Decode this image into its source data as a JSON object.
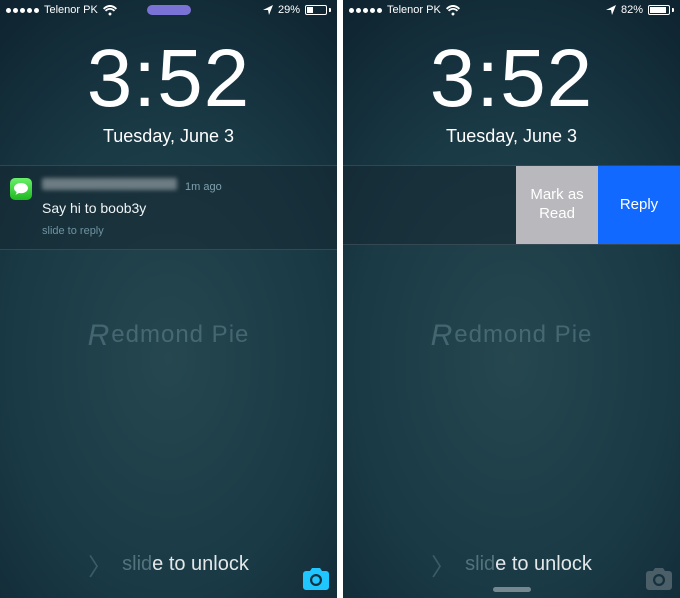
{
  "left": {
    "status": {
      "carrier": "Telenor PK",
      "signal_dots": 5,
      "wifi_bars": 3,
      "has_loading_pill": true,
      "location_arrow": true,
      "battery_pct_label": "29%",
      "battery_fill_pct": 29
    },
    "time": "3:52",
    "date": "Tuesday, June 3",
    "notif": {
      "app_icon_name": "messages-icon",
      "relative_time": "1m ago",
      "message": "Say hi to boob3y",
      "hint": "slide to reply",
      "sender_blurred": true
    },
    "watermark_text": "edmond Pie",
    "unlock_dim_prefix": "slid",
    "unlock_bright_suffix": "e to unlock",
    "camera_tint": "#1fc6ff"
  },
  "right": {
    "status": {
      "carrier": "Telenor PK",
      "signal_dots": 5,
      "wifi_bars": 3,
      "has_loading_pill": false,
      "location_arrow": true,
      "battery_pct_label": "82%",
      "battery_fill_pct": 82
    },
    "time": "3:52",
    "date": "Tuesday, June 3",
    "actions": {
      "mark_read": "Mark as Read",
      "reply": "Reply"
    },
    "watermark_text": "edmond Pie",
    "unlock_dim_prefix": "slid",
    "unlock_bright_suffix": "e to unlock",
    "camera_tint": "#4a5f67",
    "show_grabber": true
  }
}
